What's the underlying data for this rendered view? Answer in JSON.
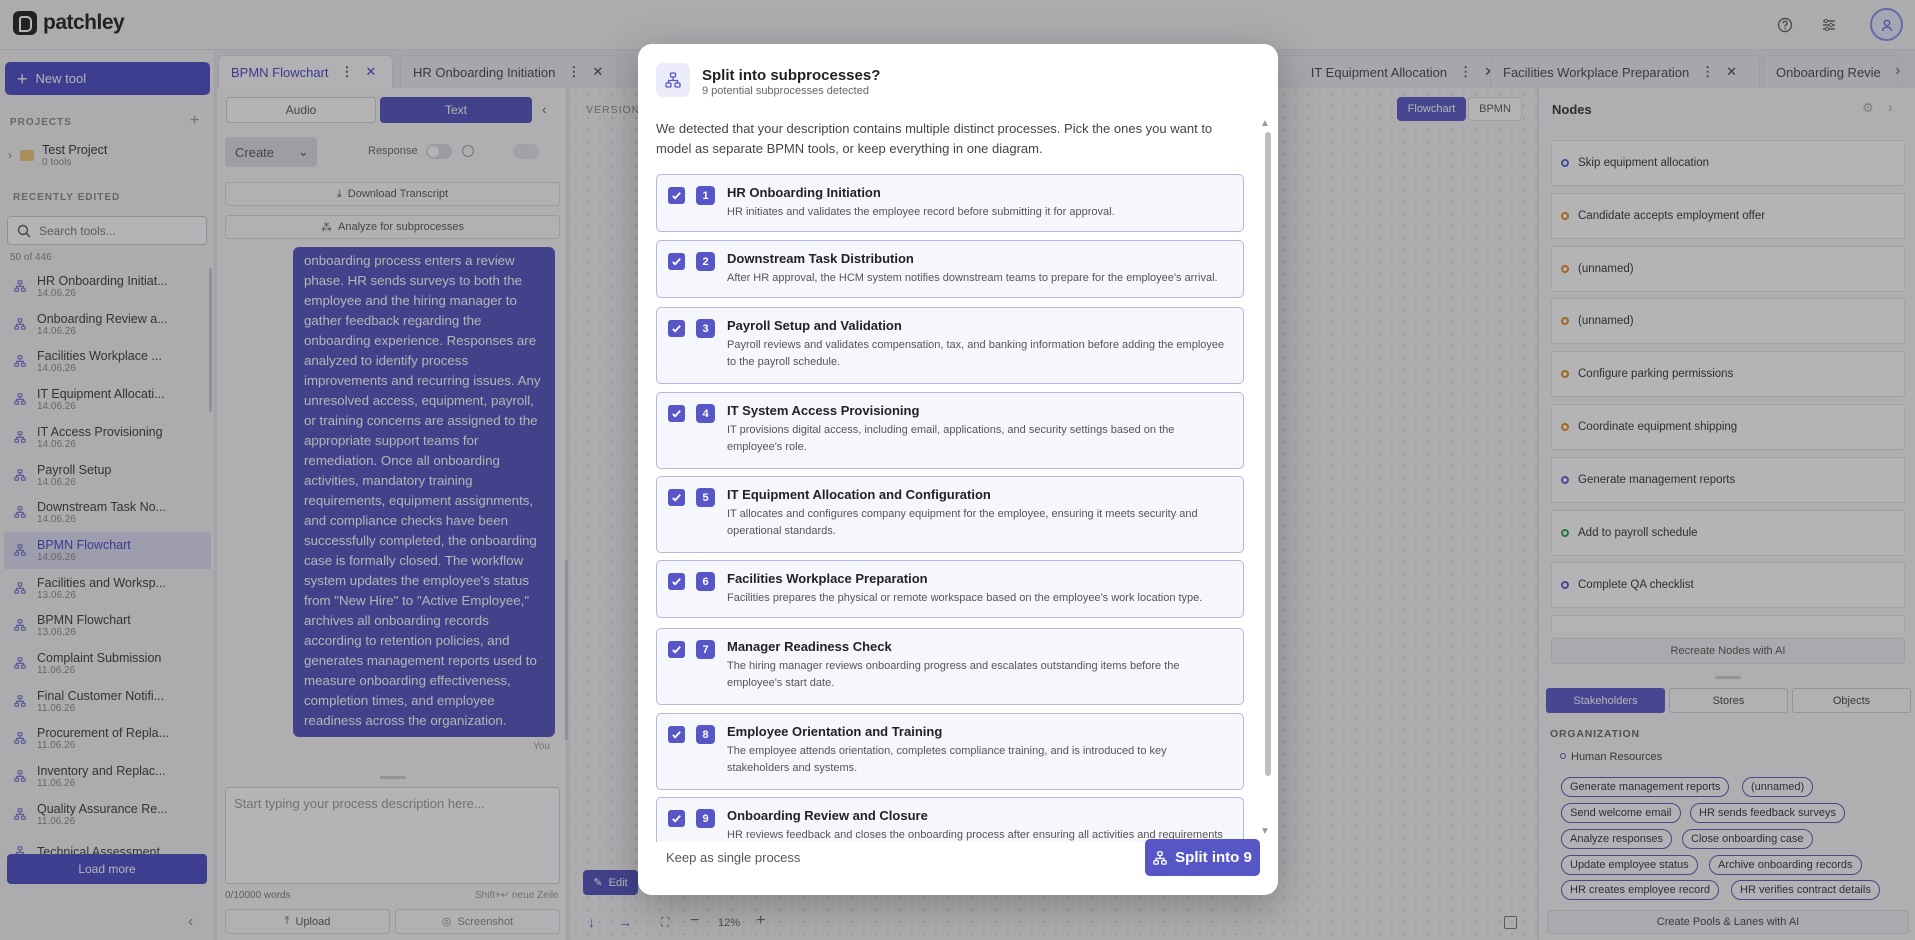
{
  "app": {
    "logo_text": "patchley"
  },
  "sidebar": {
    "new_tool_label": "New tool",
    "projects_label": "PROJECTS",
    "project": {
      "name": "Test Project",
      "count": "0 tools"
    },
    "recent_label": "RECENTLY EDITED",
    "search_placeholder": "Search tools...",
    "count_label": "50 of 446",
    "items": [
      {
        "name": "HR Onboarding Initiat...",
        "date": "14.06.26"
      },
      {
        "name": "Onboarding Review a...",
        "date": "14.06.26"
      },
      {
        "name": "Facilities Workplace ...",
        "date": "14.06.26"
      },
      {
        "name": "IT Equipment Allocati...",
        "date": "14.06.26"
      },
      {
        "name": "IT Access Provisioning",
        "date": "14.06.26"
      },
      {
        "name": "Payroll Setup",
        "date": "14.06.26"
      },
      {
        "name": "Downstream Task No...",
        "date": "14.06.26"
      },
      {
        "name": "BPMN Flowchart",
        "date": "14.06.26"
      },
      {
        "name": "Facilities and Worksp...",
        "date": "13.06.26"
      },
      {
        "name": "BPMN Flowchart",
        "date": "13.06.26"
      },
      {
        "name": "Complaint Submission",
        "date": "11.06.26"
      },
      {
        "name": "Final Customer Notifi...",
        "date": "11.06.26"
      },
      {
        "name": "Procurement of Repla...",
        "date": "11.06.26"
      },
      {
        "name": "Inventory and Replac...",
        "date": "11.06.26"
      },
      {
        "name": "Quality Assurance Re...",
        "date": "11.06.26"
      },
      {
        "name": "Technical Assessment",
        "date": ""
      }
    ],
    "load_more_label": "Load more"
  },
  "tabs": [
    {
      "label": "BPMN Flowchart"
    },
    {
      "label": "HR Onboarding Initiation"
    },
    {
      "label": "IT Equipment Allocation"
    },
    {
      "label": "Facilities Workplace Preparation"
    },
    {
      "label": "Onboarding Revie"
    }
  ],
  "left_panel": {
    "audio_label": "Audio",
    "text_label": "Text",
    "create_label": "Create",
    "response_label": "Response",
    "download_label": "Download Transcript",
    "analyze_label": "Analyze for subprocesses",
    "chat_lines": [
      "onboarding process enters a review",
      "phase. HR sends surveys to both the",
      "employee and the hiring manager to",
      "gather feedback regarding the",
      "onboarding experience. Responses are",
      "analyzed to identify process",
      "improvements and recurring issues. Any",
      "unresolved access, equipment, payroll,",
      "or training concerns are assigned to the",
      "appropriate support teams for",
      "remediation. Once all onboarding",
      "activities, mandatory training",
      "requirements, equipment assignments,",
      "and compliance checks have been",
      "successfully completed, the onboarding",
      "case is formally closed. The workflow",
      "system updates the employee's status",
      "from \"New Hire\" to \"Active Employee,\"",
      "archives all onboarding records",
      "according to retention policies, and",
      "generates management reports used to",
      "measure onboarding effectiveness,",
      "completion times, and employee",
      "readiness across the organization."
    ],
    "you_label": "You",
    "input_placeholder": "Start typing your process description here...",
    "word_count": "0/10000 words",
    "shortcut_hint": "Shift+↵ neue Zeile",
    "upload_label": "Upload",
    "screenshot_label": "Screenshot"
  },
  "canvas": {
    "version_label": "VERSION",
    "flowchart_label": "Flowchart",
    "bpmn_label": "BPMN",
    "edit_label": "Edit",
    "zoom_label": "12%"
  },
  "right_panel": {
    "nodes_title": "Nodes",
    "nodes": [
      {
        "label": "Skip equipment allocation",
        "color": "#5b5bd6"
      },
      {
        "label": "Candidate accepts employment offer",
        "color": "#e08a1e"
      },
      {
        "label": "(unnamed)",
        "color": "#e08a1e"
      },
      {
        "label": "(unnamed)",
        "color": "#e08a1e"
      },
      {
        "label": "Configure parking permissions",
        "color": "#e08a1e"
      },
      {
        "label": "Coordinate equipment shipping",
        "color": "#e08a1e"
      },
      {
        "label": "Generate management reports",
        "color": "#5b5bd6"
      },
      {
        "label": "Add to payroll schedule",
        "color": "#2fa34a"
      },
      {
        "label": "Complete QA checklist",
        "color": "#5b5bd6"
      }
    ],
    "recreate_label": "Recreate Nodes with AI",
    "stakeholders_label": "Stakeholders",
    "stores_label": "Stores",
    "objects_label": "Objects",
    "org_label": "ORGANIZATION",
    "org_name": "Human Resources",
    "chips": [
      "Generate management reports",
      "(unnamed)",
      "Send welcome email",
      "HR sends feedback surveys",
      "Analyze responses",
      "Close onboarding case",
      "Update employee status",
      "Archive onboarding records",
      "HR creates employee record",
      "HR verifies contract details"
    ],
    "pools_label": "Create Pools & Lanes with AI"
  },
  "modal": {
    "title": "Split into subprocesses?",
    "subtitle": "9 potential subprocesses detected",
    "intro": "We detected that your description contains multiple distinct processes. Pick the ones you want to model as separate BPMN tools, or keep everything in one diagram.",
    "items": [
      {
        "num": "1",
        "title": "HR Onboarding Initiation",
        "desc": "HR initiates and validates the employee record before submitting it for approval."
      },
      {
        "num": "2",
        "title": "Downstream Task Distribution",
        "desc": "After HR approval, the HCM system notifies downstream teams to prepare for the employee's arrival."
      },
      {
        "num": "3",
        "title": "Payroll Setup and Validation",
        "desc": "Payroll reviews and validates compensation, tax, and banking information before adding the employee to the payroll schedule."
      },
      {
        "num": "4",
        "title": "IT System Access Provisioning",
        "desc": "IT provisions digital access, including email, applications, and security settings based on the employee's role."
      },
      {
        "num": "5",
        "title": "IT Equipment Allocation and Configuration",
        "desc": "IT allocates and configures company equipment for the employee, ensuring it meets security and operational standards."
      },
      {
        "num": "6",
        "title": "Facilities Workplace Preparation",
        "desc": "Facilities prepares the physical or remote workspace based on the employee's work location type."
      },
      {
        "num": "7",
        "title": "Manager Readiness Check",
        "desc": "The hiring manager reviews onboarding progress and escalates outstanding items before the employee's start date."
      },
      {
        "num": "8",
        "title": "Employee Orientation and Training",
        "desc": "The employee attends orientation, completes compliance training, and is introduced to key stakeholders and systems."
      },
      {
        "num": "9",
        "title": "Onboarding Review and Closure",
        "desc": "HR reviews feedback and closes the onboarding process after ensuring all activities and requirements"
      }
    ],
    "keep_label": "Keep as single process",
    "split_label": "Split into 9"
  }
}
